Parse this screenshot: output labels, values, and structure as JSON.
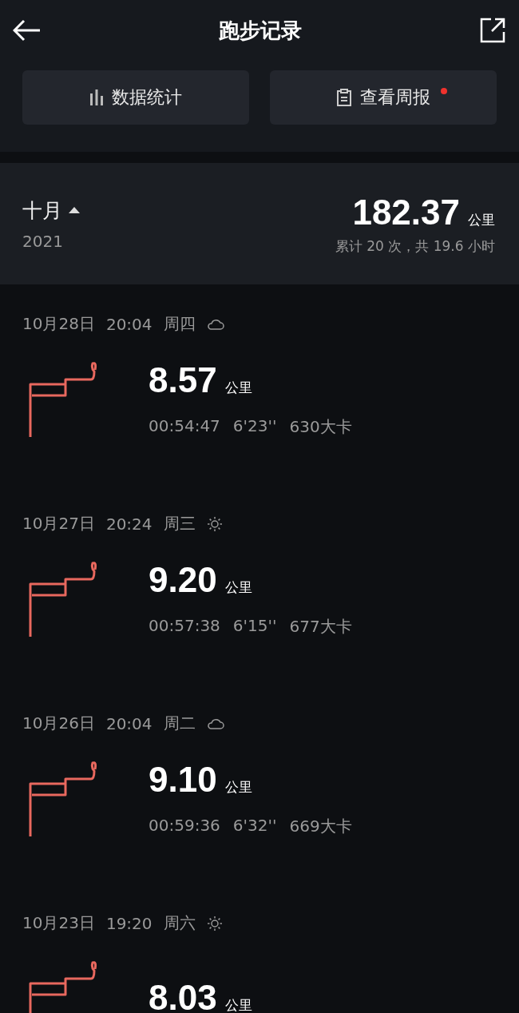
{
  "header": {
    "title": "跑步记录"
  },
  "actions": [
    {
      "kind": "stats",
      "label": "数据统计",
      "badge": false
    },
    {
      "kind": "report",
      "label": "查看周报",
      "badge": true
    }
  ],
  "summary": {
    "month": "十月",
    "expanded": true,
    "year": "2021",
    "distance": "182.37",
    "unit": "公里",
    "detail": "累计 20 次，共 19.6 小时"
  },
  "records": [
    {
      "date": "10月28日",
      "time": "20:04",
      "weekday": "周四",
      "kind": "cloud",
      "distance": "8.57",
      "unit": "公里",
      "duration": "00:54:47",
      "pace": "6'23''",
      "calories": "630大卡"
    },
    {
      "date": "10月27日",
      "time": "20:24",
      "weekday": "周三",
      "kind": "sun",
      "distance": "9.20",
      "unit": "公里",
      "duration": "00:57:38",
      "pace": "6'15''",
      "calories": "677大卡"
    },
    {
      "date": "10月26日",
      "time": "20:04",
      "weekday": "周二",
      "kind": "cloud",
      "distance": "9.10",
      "unit": "公里",
      "duration": "00:59:36",
      "pace": "6'32''",
      "calories": "669大卡"
    },
    {
      "date": "10月23日",
      "time": "19:20",
      "weekday": "周六",
      "kind": "sun",
      "distance": "8.03",
      "unit": "公里"
    }
  ]
}
